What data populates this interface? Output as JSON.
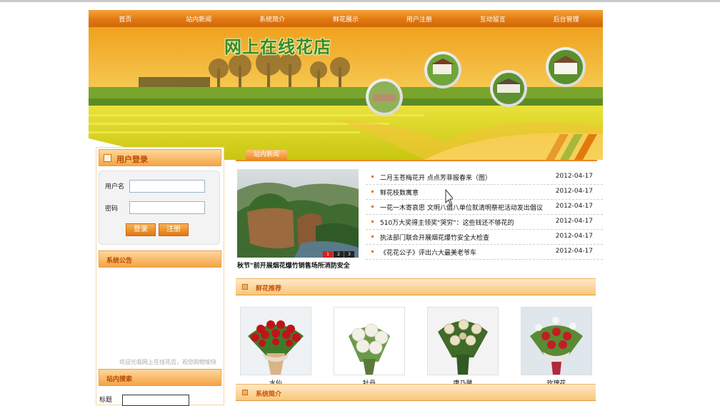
{
  "nav": {
    "items": [
      "首页",
      "站内新闻",
      "系统简介",
      "鲜花展示",
      "用户注册",
      "互动留言",
      "后台管理"
    ]
  },
  "banner": {
    "title": "网上在线花店"
  },
  "login": {
    "title": "用户登录",
    "username_label": "用户名",
    "password_label": "密码",
    "login_button": "登录",
    "register_button": "注册"
  },
  "announcement": {
    "title": "系统公告",
    "partial_text": "欢迎光临网上在线花店，祝您购物愉快"
  },
  "search": {
    "title": "站内搜索",
    "field_label": "标题"
  },
  "news": {
    "tab_label": "站内新闻",
    "image_caption": "秋节\"前开展烟花爆竹销售场所消防安全",
    "slider_dots": [
      "1",
      "2",
      "3"
    ],
    "items": [
      {
        "title": "二月玉苍梅花开 点点芳菲报春来（图）",
        "date": "2012-04-17"
      },
      {
        "title": "鲜花枝数寓意",
        "date": "2012-04-17"
      },
      {
        "title": "一花一木寄哀思 文明八倡八单位就清明祭祀活动发出倡议",
        "date": "2012-04-17"
      },
      {
        "title": "510万大奖得主领奖\"哭穷\"：这些钱还不够花的",
        "date": "2012-04-17"
      },
      {
        "title": "执法部门联合开展烟花爆竹安全大检查",
        "date": "2012-04-17"
      },
      {
        "title": "《花花公子》评出六大最美老爷车",
        "date": "2012-04-17"
      }
    ]
  },
  "recommend": {
    "title": "鲜花推荐",
    "products": [
      {
        "name": "水仙"
      },
      {
        "name": "牡丹"
      },
      {
        "name": "康乃馨"
      },
      {
        "name": "玫瑰花"
      }
    ]
  },
  "intro": {
    "title": "系统简介"
  },
  "colors": {
    "nav_orange": "#e2780f",
    "title_green": "#3b8a29",
    "section_text": "#c4520a"
  }
}
